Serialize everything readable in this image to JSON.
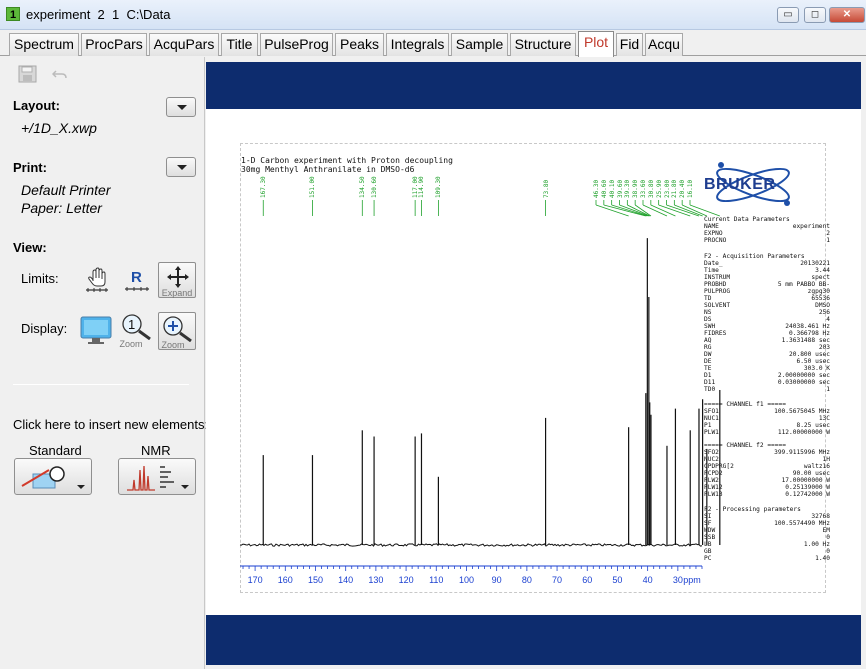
{
  "window": {
    "badge": "1",
    "title": "experiment  2  1  C:\\Data",
    "buttons": {
      "minimize": "▭",
      "maximize": "◻",
      "close": "✕"
    }
  },
  "tabs": [
    {
      "label": "Spectrum"
    },
    {
      "label": "ProcPars"
    },
    {
      "label": "AcquPars"
    },
    {
      "label": "Title"
    },
    {
      "label": "PulseProg"
    },
    {
      "label": "Peaks"
    },
    {
      "label": "Integrals"
    },
    {
      "label": "Sample"
    },
    {
      "label": "Structure"
    },
    {
      "label": "Plot",
      "active": true
    },
    {
      "label": "Fid"
    },
    {
      "label": "Acqu"
    }
  ],
  "left": {
    "layout_label": "Layout:",
    "layout_file": "+/1D_X.xwp",
    "print_label": "Print:",
    "printer": "Default Printer",
    "paper": "Paper: Letter",
    "view_label": "View:",
    "limits_label": "Limits:",
    "expand_label": "Expand",
    "display_label": "Display:",
    "zoom1_label": "Zoom",
    "zoom2_label": "Zoom",
    "insert_label": "Click here to insert new elements:",
    "standard_label": "Standard",
    "nmr_label": "NMR"
  },
  "plot": {
    "title_line1": "1-D Carbon experiment with Proton decoupling",
    "title_line2": "30mg Menthyl Anthranilate in DMSO-d6",
    "logo_text": "BRUKER",
    "current_header": "Current Data Parameters",
    "current": [
      {
        "k": "NAME",
        "v": "experiment"
      },
      {
        "k": "EXPNO",
        "v": "2"
      },
      {
        "k": "PROCNO",
        "v": "1"
      }
    ],
    "acq_header": "F2 - Acquisition Parameters",
    "acq": [
      {
        "k": "Date_",
        "v": "20130221"
      },
      {
        "k": "Time",
        "v": "3.44"
      },
      {
        "k": "INSTRUM",
        "v": "spect"
      },
      {
        "k": "PROBHD",
        "v": "5 mm PABBO BB-"
      },
      {
        "k": "PULPROG",
        "v": "zgpg30"
      },
      {
        "k": "TD",
        "v": "65536"
      },
      {
        "k": "SOLVENT",
        "v": "DMSO"
      },
      {
        "k": "NS",
        "v": "256"
      },
      {
        "k": "DS",
        "v": "4"
      },
      {
        "k": "SWH",
        "v": "24038.461 Hz"
      },
      {
        "k": "FIDRES",
        "v": "0.366798 Hz"
      },
      {
        "k": "AQ",
        "v": "1.3631488 sec"
      },
      {
        "k": "RG",
        "v": "203"
      },
      {
        "k": "DW",
        "v": "20.800 usec"
      },
      {
        "k": "DE",
        "v": "6.50 usec"
      },
      {
        "k": "TE",
        "v": "303.0 K"
      },
      {
        "k": "D1",
        "v": "2.00000000 sec"
      },
      {
        "k": "D11",
        "v": "0.03000000 sec"
      },
      {
        "k": "TD0",
        "v": "1"
      }
    ],
    "ch1_header": "===== CHANNEL f1 =====",
    "ch1": [
      {
        "k": "SFO1",
        "v": "100.5675045 MHz"
      },
      {
        "k": "NUC1",
        "v": "13C"
      },
      {
        "k": "P1",
        "v": "8.25 usec"
      },
      {
        "k": "PLW1",
        "v": "112.00000000 W"
      }
    ],
    "ch2_header": "===== CHANNEL f2 =====",
    "ch2": [
      {
        "k": "SFO2",
        "v": "399.9115996 MHz"
      },
      {
        "k": "NUC2",
        "v": "1H"
      },
      {
        "k": "CPDPRG[2",
        "v": "waltz16"
      },
      {
        "k": "PCPD2",
        "v": "90.00 usec"
      },
      {
        "k": "PLW2",
        "v": "17.00000000 W"
      },
      {
        "k": "PLW12",
        "v": "0.25139000 W"
      },
      {
        "k": "PLW13",
        "v": "0.12742000 W"
      }
    ],
    "proc_header": "F2 - Processing parameters",
    "proc": [
      {
        "k": "SI",
        "v": "32768"
      },
      {
        "k": "SF",
        "v": "100.5574490 MHz"
      },
      {
        "k": "WDW",
        "v": "EM"
      },
      {
        "k": "SSB",
        "v": "0"
      },
      {
        "k": "LB",
        "v": "1.00 Hz"
      },
      {
        "k": "GB",
        "v": "0"
      },
      {
        "k": "PC",
        "v": "1.40"
      }
    ],
    "axis_unit": "ppm"
  },
  "chart_data": {
    "type": "line",
    "title": "1-D Carbon experiment with Proton decoupling",
    "subtitle": "30mg Menthyl Anthranilate in DMSO-d6",
    "xlabel": "ppm",
    "ylabel": "",
    "x_reversed": true,
    "xlim": [
      175,
      22
    ],
    "x_ticks": [
      170,
      160,
      150,
      140,
      130,
      120,
      110,
      100,
      90,
      80,
      70,
      60,
      50,
      40,
      30
    ],
    "peaks": [
      {
        "ppm": 167.3,
        "height": 0.29
      },
      {
        "ppm": 151.0,
        "height": 0.29
      },
      {
        "ppm": 134.5,
        "height": 0.37
      },
      {
        "ppm": 130.6,
        "height": 0.35
      },
      {
        "ppm": 117.0,
        "height": 0.35
      },
      {
        "ppm": 114.9,
        "height": 0.36
      },
      {
        "ppm": 109.3,
        "height": 0.22
      },
      {
        "ppm": 73.8,
        "height": 0.41
      },
      {
        "ppm": 46.3,
        "height": 0.38
      },
      {
        "ppm": 40.6,
        "height": 0.49
      },
      {
        "ppm": 40.1,
        "height": 0.99
      },
      {
        "ppm": 39.6,
        "height": 0.8
      },
      {
        "ppm": 39.3,
        "height": 0.46
      },
      {
        "ppm": 38.9,
        "height": 0.42
      },
      {
        "ppm": 33.6,
        "height": 0.32
      },
      {
        "ppm": 30.8,
        "height": 0.44
      },
      {
        "ppm": 25.9,
        "height": 0.37
      },
      {
        "ppm": 23.0,
        "height": 0.44
      },
      {
        "ppm": 21.8,
        "height": 0.47
      },
      {
        "ppm": 20.4,
        "height": 0.31
      },
      {
        "ppm": 16.1,
        "height": 0.5
      }
    ]
  }
}
